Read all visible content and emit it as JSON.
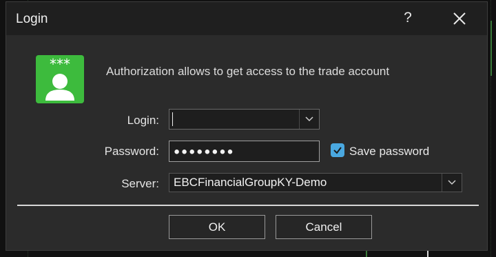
{
  "dialog": {
    "title": "Login",
    "help_label": "?",
    "info_text": "Authorization allows to get access to the trade account",
    "icon": "login-account-icon",
    "accent_color": "#3dbb3d"
  },
  "form": {
    "login_label": "Login:",
    "login_value": "",
    "password_label": "Password:",
    "password_value": "●●●●●●●●",
    "save_password_label": "Save password",
    "save_password_checked": true,
    "server_label": "Server:",
    "server_value": "EBCFinancialGroupKY-Demo"
  },
  "buttons": {
    "ok_label": "OK",
    "cancel_label": "Cancel"
  },
  "colors": {
    "checkbox": "#4aa8e0",
    "dialog_bg": "#2b2b2b",
    "titlebar_bg": "#1f1f1f"
  }
}
